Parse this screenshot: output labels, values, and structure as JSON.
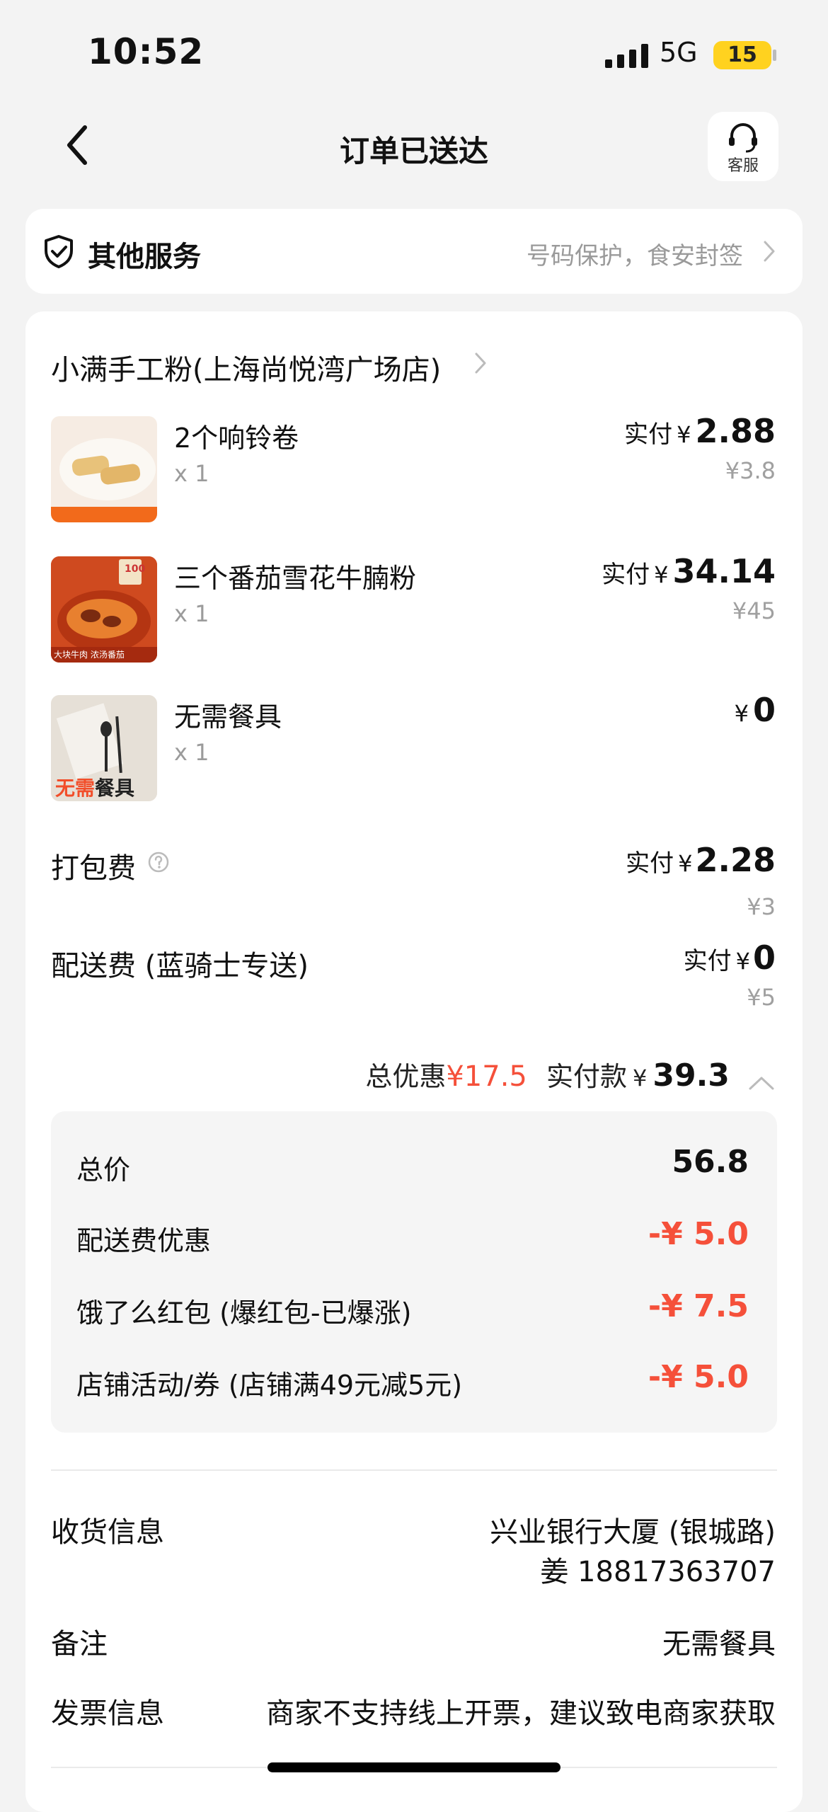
{
  "status_bar": {
    "time": "10:52",
    "network": "5G",
    "battery": "15"
  },
  "nav": {
    "title": "订单已送达",
    "customer_service_label": "客服"
  },
  "service": {
    "title": "其他服务",
    "description": "号码保护，食安封签"
  },
  "shop": {
    "name": "小满手工粉(上海尚悦湾广场店)"
  },
  "items": [
    {
      "name": "2个响铃卷",
      "qty": "x 1",
      "pay_label": "实付",
      "currency": "¥",
      "price": "2.88",
      "original": "¥3.8"
    },
    {
      "name": "三个番茄雪花牛腩粉",
      "qty": "x 1",
      "pay_label": "实付",
      "currency": "¥",
      "price": "34.14",
      "original": "¥45",
      "badge_text": "100",
      "img_caption": "大块牛肉 浓汤番茄"
    },
    {
      "name": "无需餐具",
      "qty": "x 1",
      "currency": "¥",
      "price": "0",
      "img_caption_a": "无需",
      "img_caption_b": "餐具"
    }
  ],
  "fees": [
    {
      "label": "打包费",
      "pay_label": "实付",
      "currency": "¥",
      "price": "2.28",
      "original": "¥3"
    },
    {
      "label": "配送费 (蓝骑士专送)",
      "pay_label": "实付",
      "currency": "¥",
      "price": "0",
      "original": "¥5"
    }
  ],
  "summary": {
    "discount_label": "总优惠",
    "discount_value": "¥17.5",
    "paid_label": "实付款",
    "currency": "¥",
    "paid_value": "39.3"
  },
  "breakdown": [
    {
      "label": "总价",
      "value": "56.8"
    },
    {
      "label": "配送费优惠",
      "value": "-¥ 5.0"
    },
    {
      "label": "饿了么红包 (爆红包-已爆涨)",
      "value": "-¥ 7.5"
    },
    {
      "label": "店铺活动/券 (店铺满49元减5元)",
      "value": "-¥ 5.0"
    }
  ],
  "info": {
    "delivery_label": "收货信息",
    "delivery_address": "兴业银行大厦 (银城路)",
    "delivery_contact": "姜 18817363707",
    "remark_label": "备注",
    "remark_value": "无需餐具",
    "invoice_label": "发票信息",
    "invoice_value": "商家不支持线上开票，建议致电商家获取"
  },
  "colors": {
    "accent_red": "#f5503a",
    "battery_yellow": "#ffd21f",
    "page_bg": "#f3f3f3"
  }
}
